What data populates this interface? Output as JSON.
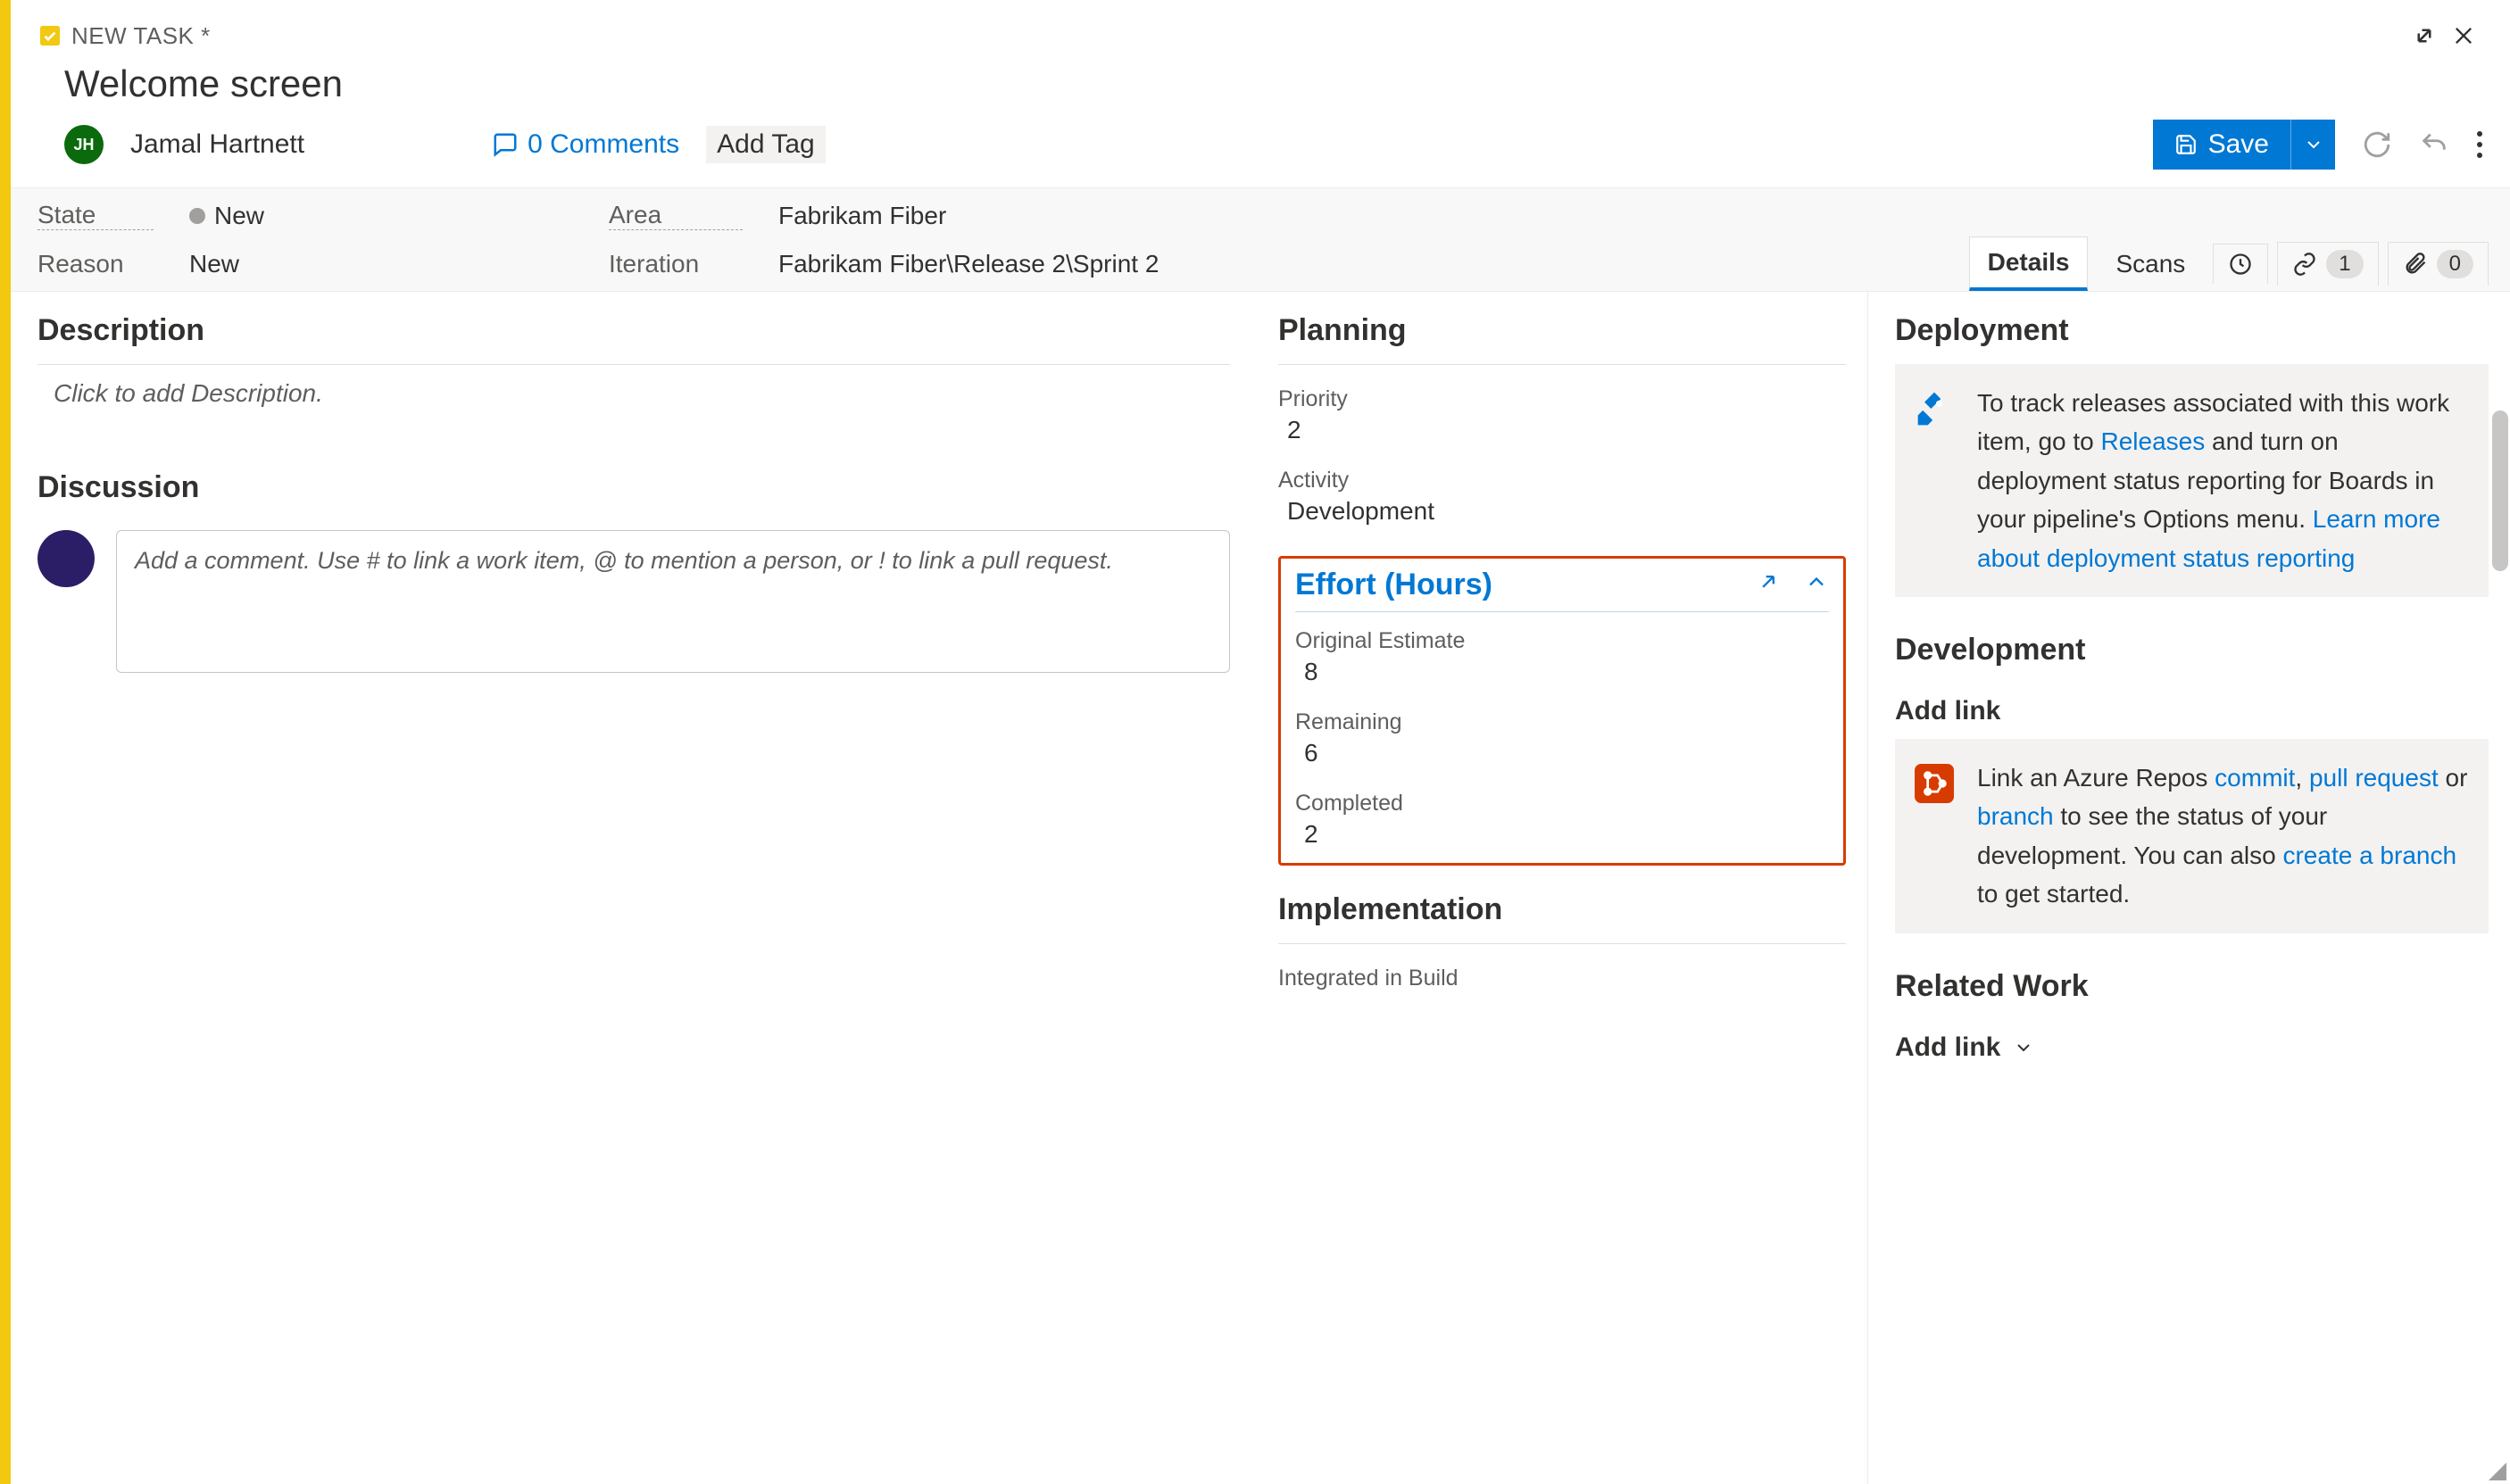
{
  "header": {
    "task_type": "NEW TASK *",
    "title": "Welcome screen",
    "avatar_initials": "JH",
    "assignee": "Jamal Hartnett",
    "comments_label": "0 Comments",
    "add_tag_label": "Add Tag",
    "save_label": "Save"
  },
  "meta": {
    "state_label": "State",
    "state_value": "New",
    "reason_label": "Reason",
    "reason_value": "New",
    "area_label": "Area",
    "area_value": "Fabrikam Fiber",
    "iteration_label": "Iteration",
    "iteration_value": "Fabrikam Fiber\\Release 2\\Sprint 2"
  },
  "tabs": {
    "details": "Details",
    "scans": "Scans",
    "links_count": "1",
    "attach_count": "0"
  },
  "left": {
    "description_title": "Description",
    "description_placeholder": "Click to add Description.",
    "discussion_title": "Discussion",
    "discussion_placeholder": "Add a comment. Use # to link a work item, @ to mention a person, or ! to link a pull request."
  },
  "planning": {
    "title": "Planning",
    "priority_label": "Priority",
    "priority_value": "2",
    "activity_label": "Activity",
    "activity_value": "Development"
  },
  "effort": {
    "title": "Effort (Hours)",
    "original_label": "Original Estimate",
    "original_value": "8",
    "remaining_label": "Remaining",
    "remaining_value": "6",
    "completed_label": "Completed",
    "completed_value": "2"
  },
  "implementation": {
    "title": "Implementation",
    "integrated_label": "Integrated in Build"
  },
  "deployment": {
    "title": "Deployment",
    "text1": "To track releases associated with this work item, go to ",
    "releases_link": "Releases",
    "text2": " and turn on deployment status reporting for Boards in your pipeline's Options menu. ",
    "learn_link": "Learn more about deployment status reporting"
  },
  "development": {
    "title": "Development",
    "add_link": "Add link",
    "text1": "Link an Azure Repos ",
    "commit_link": "commit",
    "text2": ", ",
    "pr_link": "pull request",
    "text3": " or ",
    "branch_link": "branch",
    "text4": " to see the status of your development. You can also ",
    "create_link": "create a branch",
    "text5": " to get started."
  },
  "related": {
    "title": "Related Work",
    "add_link": "Add link"
  }
}
